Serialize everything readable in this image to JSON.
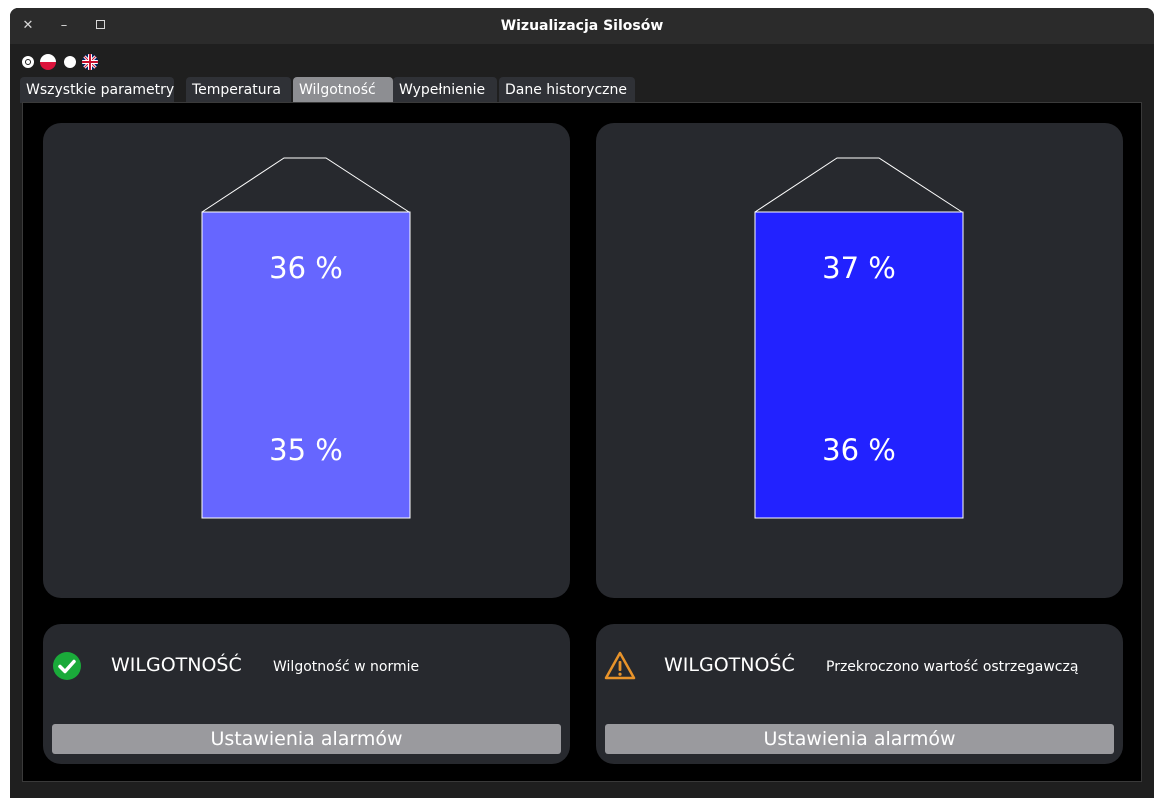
{
  "window": {
    "title": "Wizualizacja Silosów",
    "controls": [
      "close",
      "minimize",
      "maximize"
    ]
  },
  "language": {
    "options": [
      {
        "name": "pl",
        "icon": "poland-flag-icon",
        "selected": true
      },
      {
        "name": "en",
        "icon": "uk-flag-icon",
        "selected": false
      }
    ]
  },
  "tabs": [
    {
      "label": "Wszystkie parametry",
      "active": false
    },
    {
      "label": "Temperatura",
      "active": false
    },
    {
      "label": "Wilgotność",
      "active": true
    },
    {
      "label": "Wypełnienie",
      "active": false
    },
    {
      "label": "Dane historyczne",
      "active": false
    }
  ],
  "silos": [
    {
      "top_value": "36 %",
      "bottom_value": "35 %",
      "fill_color": "#6666ff"
    },
    {
      "top_value": "37 %",
      "bottom_value": "36 %",
      "fill_color": "#2222ff"
    }
  ],
  "alarms": [
    {
      "status": "ok",
      "icon": "check-circle-icon",
      "icon_color": "#1aaa3a",
      "parameter": "WILGOTNOŚĆ",
      "message": "Wilgotność w normie",
      "button_label": "Ustawienia alarmów"
    },
    {
      "status": "warning",
      "icon": "warning-triangle-icon",
      "icon_color": "#e8932a",
      "parameter": "WILGOTNOŚĆ",
      "message": "Przekroczono wartość ostrzegawczą",
      "button_label": "Ustawienia alarmów"
    }
  ]
}
